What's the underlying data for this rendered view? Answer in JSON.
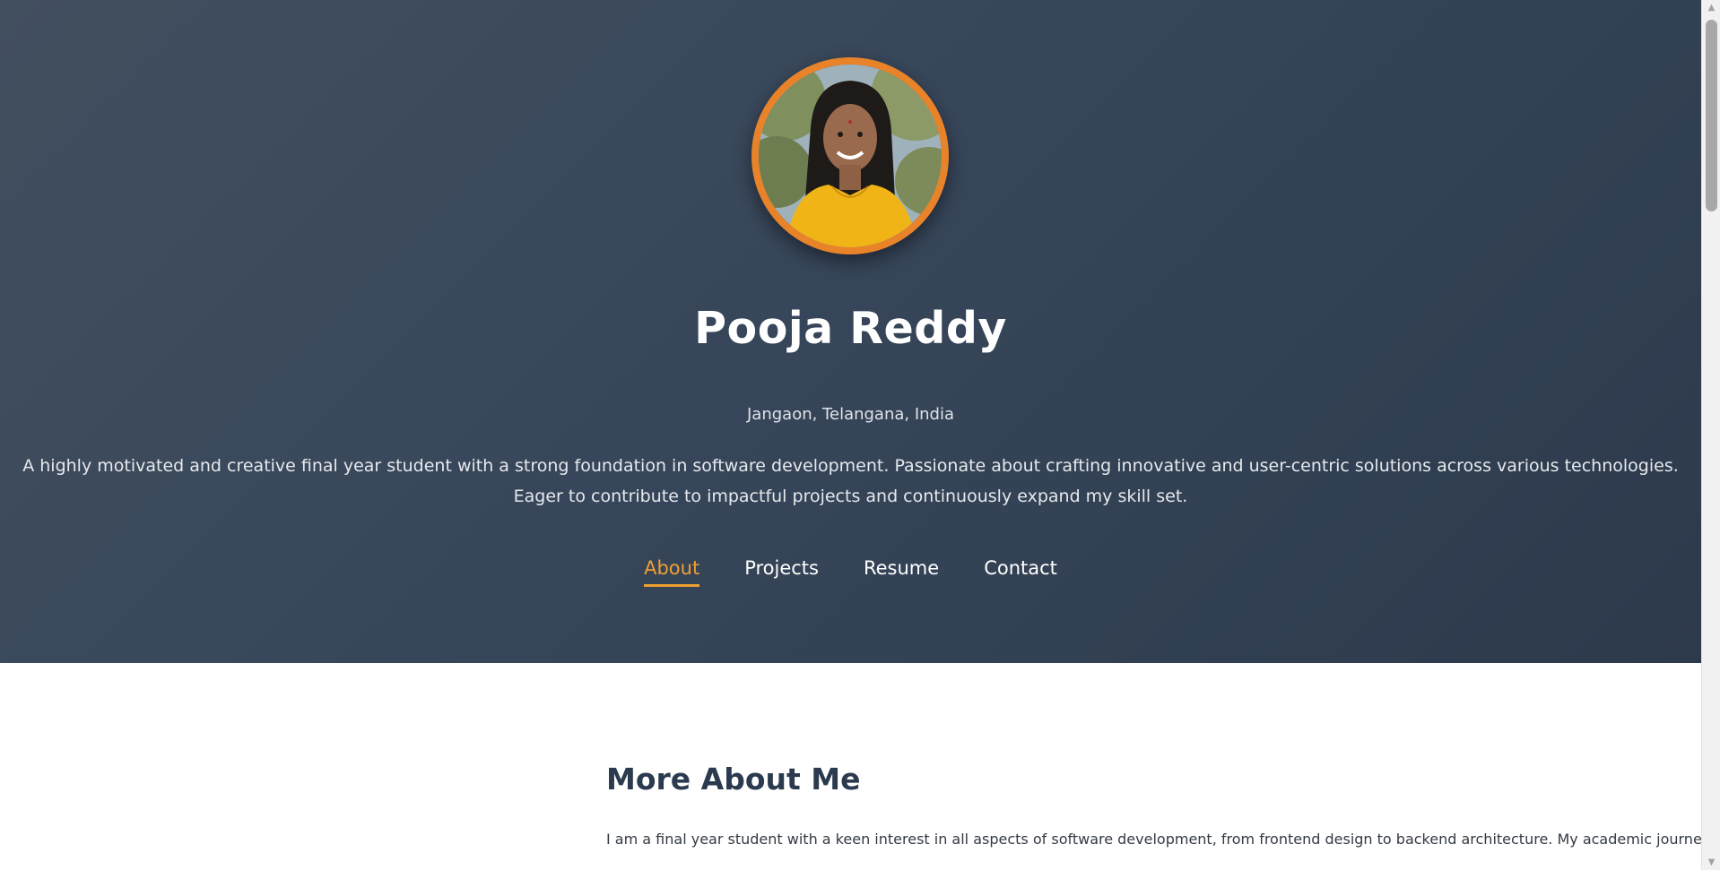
{
  "profile": {
    "name": "Pooja Reddy",
    "location": "Jangaon, Telangana, India",
    "bio": "A highly motivated and creative final year student with a strong foundation in software development. Passionate about crafting innovative and user-centric solutions across various technologies. Eager to contribute to impactful projects and continuously expand my skill set.",
    "avatar_icon": "profile-photo"
  },
  "nav": {
    "items": [
      {
        "label": "About",
        "active": true
      },
      {
        "label": "Projects",
        "active": false
      },
      {
        "label": "Resume",
        "active": false
      },
      {
        "label": "Contact",
        "active": false
      }
    ]
  },
  "about": {
    "title": "More About Me",
    "text": "I am a final year student with a keen interest in all aspects of software development, from frontend design to backend architecture. My academic journey has"
  },
  "scrollbar": {
    "up_icon": "scroll-up-arrow",
    "down_icon": "scroll-down-arrow",
    "up_glyph": "▲",
    "down_glyph": "▼"
  },
  "colors": {
    "accent": "#f0a030",
    "avatar_border": "#e8832a",
    "hero_bg": "#37465a",
    "heading": "#2b3a4e"
  }
}
